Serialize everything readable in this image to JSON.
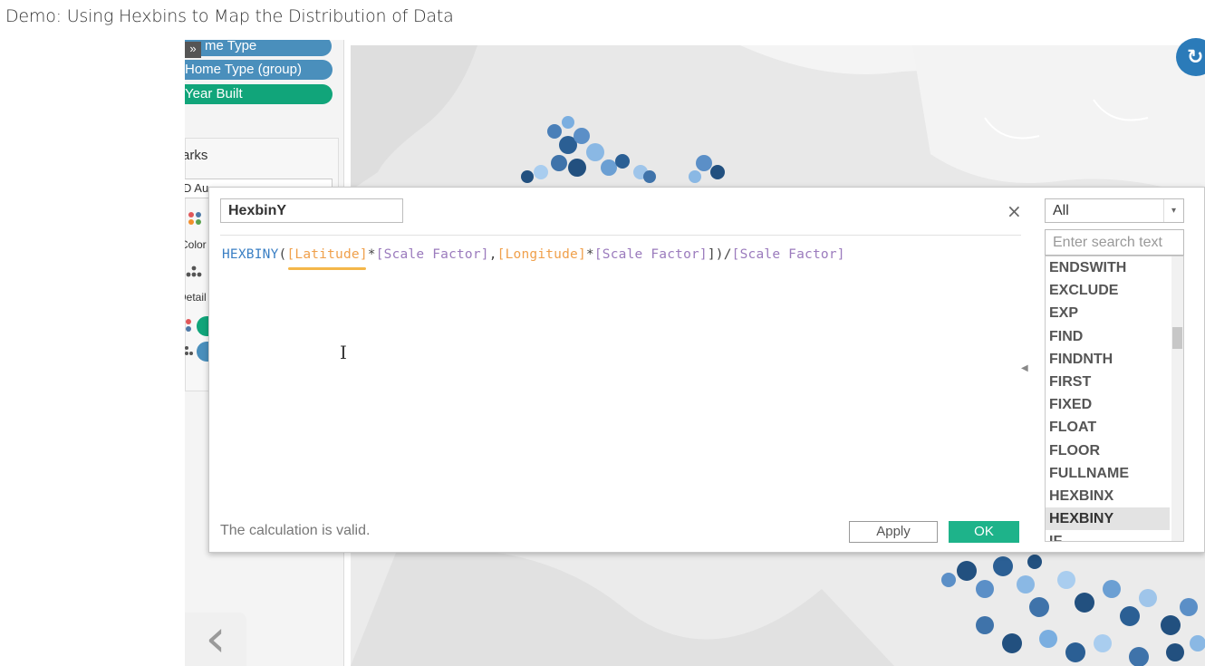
{
  "page": {
    "title": "Demo: Using Hexbins to Map the Distribution of Data"
  },
  "left_panel": {
    "collapse_glyph": "»",
    "pills": [
      "me Type",
      "Home Type (group)",
      "Year Built"
    ],
    "marks_label": "arks",
    "marks_type": "D Au",
    "color_label": "Color",
    "detail_label": "Detail",
    "back_glyph": "‹"
  },
  "map": {
    "revert_glyph": "↻"
  },
  "dialog": {
    "calc_name": "HexbinY",
    "close_glyph": "×",
    "formula": {
      "fn": "HEXBINY",
      "open_paren": "(",
      "field_1": "[Latitude]",
      "op_1": "*",
      "param_1": "[Scale Factor]",
      "comma": ",",
      "field_2": "[Longitude]",
      "op_2": "*",
      "param_2": "[Scale Factor]",
      "close_div": "])/",
      "param_3": "[Scale Factor]"
    },
    "cursor_glyph": "I",
    "status": "The calculation is valid.",
    "apply_label": "Apply",
    "ok_label": "OK"
  },
  "functions": {
    "category": "All",
    "search_placeholder": "Enter search text",
    "items": [
      "ENDSWITH",
      "EXCLUDE",
      "EXP",
      "FIND",
      "FINDNTH",
      "FIRST",
      "FIXED",
      "FLOAT",
      "FLOOR",
      "FULLNAME",
      "HEXBINX",
      "HEXBINY",
      "IF"
    ],
    "selected": "HEXBINY"
  },
  "colors": {
    "pill_blue": "#4a8fbc",
    "pill_green": "#11a57a",
    "ok_green": "#1eb38a",
    "formula_function": "#3a7fc4",
    "formula_field": "#f0a04b",
    "formula_parameter": "#9b7bbd"
  }
}
